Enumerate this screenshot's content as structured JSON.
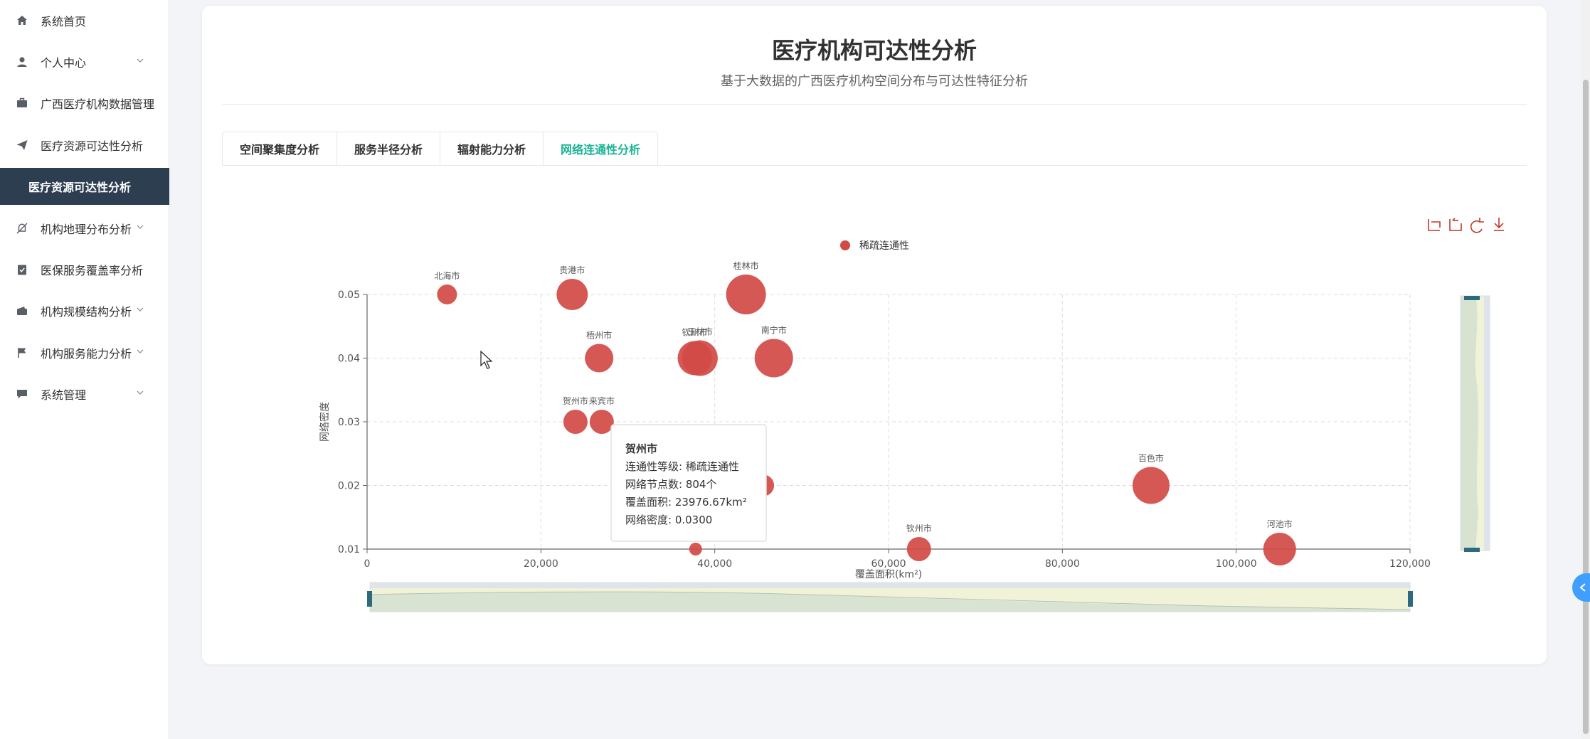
{
  "sidebar": {
    "items": [
      {
        "label": "系统首页",
        "icon": "home-icon",
        "chevron": false
      },
      {
        "label": "个人中心",
        "icon": "user-icon",
        "chevron": true
      },
      {
        "label": "广西医疗机构数据管理",
        "icon": "briefcase-icon",
        "chevron": false
      },
      {
        "label": "医疗资源可达性分析",
        "icon": "paper-plane-icon",
        "chevron": false
      },
      {
        "label": "医疗资源可达性分析",
        "icon": "",
        "chevron": false,
        "active": true
      },
      {
        "label": "机构地理分布分析",
        "icon": "bell-off-icon",
        "chevron": true
      },
      {
        "label": "医保服务覆盖率分析",
        "icon": "clipboard-check-icon",
        "chevron": false
      },
      {
        "label": "机构规模结构分析",
        "icon": "wallet-icon",
        "chevron": true
      },
      {
        "label": "机构服务能力分析",
        "icon": "flag-icon",
        "chevron": true
      },
      {
        "label": "系统管理",
        "icon": "chat-icon",
        "chevron": true
      }
    ]
  },
  "page": {
    "title": "医疗机构可达性分析",
    "subtitle": "基于大数据的广西医疗机构空间分布与可达性特征分析"
  },
  "tabs": [
    {
      "label": "空间聚集度分析",
      "active": false
    },
    {
      "label": "服务半径分析",
      "active": false
    },
    {
      "label": "辐射能力分析",
      "active": false
    },
    {
      "label": "网络连通性分析",
      "active": true
    }
  ],
  "toolbox": [
    "zoom-icon",
    "zoom-reset-icon",
    "restore-icon",
    "download-icon"
  ],
  "colors": {
    "accent": "#1ab394",
    "bubble": "#d14a45",
    "sidebar_active": "#2c3e50"
  },
  "chart_data": {
    "type": "scatter",
    "legend": [
      "稀疏连通性"
    ],
    "xlabel": "覆盖面积(km²)",
    "ylabel": "网络密度",
    "xlim": [
      0,
      120000
    ],
    "ylim": [
      0.01,
      0.05
    ],
    "xticks": [
      0,
      20000,
      40000,
      60000,
      80000,
      100000,
      120000
    ],
    "xtick_labels": [
      "0",
      "20,000",
      "40,000",
      "60,000",
      "80,000",
      "100,000",
      "120,000"
    ],
    "yticks": [
      0.01,
      0.02,
      0.03,
      0.04,
      0.05
    ],
    "ytick_labels": [
      "0.01",
      "0.02",
      "0.03",
      "0.04",
      "0.05"
    ],
    "grid": true,
    "legend_position": "top",
    "series": [
      {
        "name": "稀疏连通性",
        "points": [
          {
            "name": "北海市",
            "x": 9200,
            "y": 0.05,
            "size": 14
          },
          {
            "name": "贵港市",
            "x": 23600,
            "y": 0.05,
            "size": 22
          },
          {
            "name": "桂林市",
            "x": 43600,
            "y": 0.05,
            "size": 28
          },
          {
            "name": "梧州市",
            "x": 26700,
            "y": 0.04,
            "size": 20
          },
          {
            "name": "钦州市",
            "x": 37700,
            "y": 0.04,
            "size": 24
          },
          {
            "name": "玉林市",
            "x": 38300,
            "y": 0.04,
            "size": 25
          },
          {
            "name": "南宁市",
            "x": 46800,
            "y": 0.04,
            "size": 27
          },
          {
            "name": "贺州市",
            "x": 23976.67,
            "y": 0.03,
            "size": 17
          },
          {
            "name": "来宾市",
            "x": 27000,
            "y": 0.03,
            "size": 17
          },
          {
            "name": "",
            "x": 45600,
            "y": 0.02,
            "size": 15
          },
          {
            "name": "",
            "x": 37800,
            "y": 0.01,
            "size": 9
          },
          {
            "name": "钦州市",
            "x": 63500,
            "y": 0.01,
            "size": 17
          },
          {
            "name": "百色市",
            "x": 90200,
            "y": 0.02,
            "size": 26
          },
          {
            "name": "河池市",
            "x": 105000,
            "y": 0.01,
            "size": 23
          }
        ]
      }
    ]
  },
  "tooltip": {
    "title": "贺州市",
    "lines": [
      "连通性等级: 稀疏连通性",
      "网络节点数: 804个",
      "覆盖面积: 23976.67km²",
      "网络密度: 0.0300"
    ]
  }
}
